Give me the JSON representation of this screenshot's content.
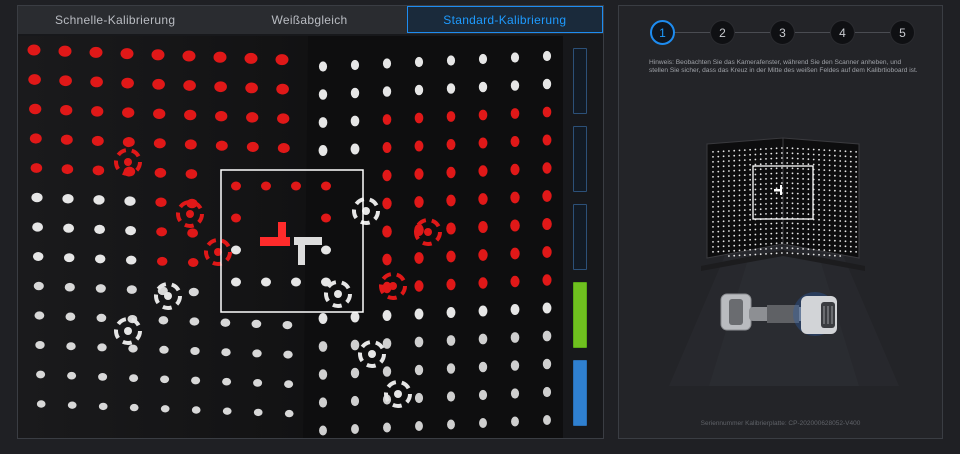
{
  "tabs": [
    {
      "label": "Schnelle-Kalibrierung",
      "active": false
    },
    {
      "label": "Weißabgleich",
      "active": false
    },
    {
      "label": "Standard-Kalibrierung",
      "active": true
    }
  ],
  "steps": [
    {
      "label": "1",
      "active": true
    },
    {
      "label": "2",
      "active": false
    },
    {
      "label": "3",
      "active": false
    },
    {
      "label": "4",
      "active": false
    },
    {
      "label": "5",
      "active": false
    }
  ],
  "hint": "Hinweis: Beobachten Sie das Kamerafenster, während Sie den Scanner anheben, und stellen Sie sicher, dass das Kreuz in der Mitte des weißen Feldes auf dem Kalibrtioboard ist.",
  "serial": "Seriennummer Kalibrierplatte: CP-202000628052-V400",
  "progress_indicators": [
    {
      "state": "pending"
    },
    {
      "state": "pending"
    },
    {
      "state": "pending"
    },
    {
      "state": "done-green"
    },
    {
      "state": "done-blue"
    }
  ],
  "colors": {
    "accent": "#1e8cf0",
    "marker_red": "#e01818",
    "marker_white": "#e6e6e6",
    "progress_green": "#6fc11f",
    "progress_blue": "#2f80d0"
  },
  "icons": [
    "calibration-board-illustration",
    "scanner-illustration",
    "crosshair-icon"
  ]
}
